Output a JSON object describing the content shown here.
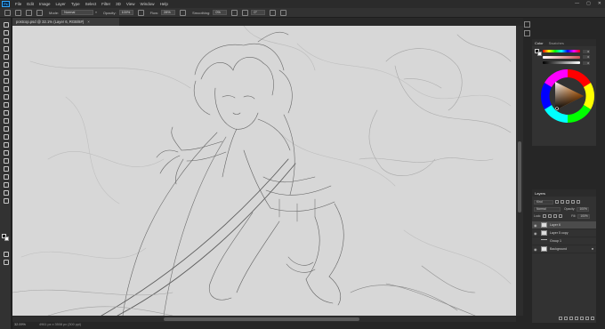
{
  "app": {
    "logo": "Ps",
    "menu": [
      "File",
      "Edit",
      "Image",
      "Layer",
      "Type",
      "Select",
      "Filter",
      "3D",
      "View",
      "Window",
      "Help"
    ],
    "window_controls": [
      "—",
      "▢",
      "✕"
    ]
  },
  "options_bar": {
    "mode_label": "Mode:",
    "mode_value": "Normal",
    "opacity_label": "Opacity:",
    "opacity_value": "100%",
    "flow_label": "Flow:",
    "flow_value": "28%",
    "smoothing_label": "Smoothing:",
    "smoothing_value": "0%",
    "angle_value": "0°"
  },
  "document": {
    "tab_title": "postcop.psd @ 32.1% (Layer 6, RGB/8#)",
    "close_glyph": "×",
    "zoom": "32.09%",
    "size_info": "4961 px x 3508 px (300 ppi)"
  },
  "color_panel": {
    "tabs": [
      "Color",
      "Swatches"
    ],
    "sliders": [
      {
        "value": "0"
      },
      {
        "value": "0"
      },
      {
        "value": "0"
      }
    ]
  },
  "layers_panel": {
    "tabs": [
      "Layers"
    ],
    "kind_label": "Kind",
    "blend_mode": "Normal",
    "opacity_label": "Opacity:",
    "opacity_value": "100%",
    "lock_label": "Lock:",
    "fill_label": "Fill:",
    "fill_value": "100%",
    "layers": [
      {
        "name": "Layer 6",
        "type": "layer",
        "visible": true
      },
      {
        "name": "Layer 5 copy",
        "type": "layer",
        "visible": true
      },
      {
        "name": "Group 1",
        "type": "group",
        "visible": false
      },
      {
        "name": "Background",
        "type": "layer",
        "visible": true,
        "locked": true
      }
    ],
    "selected_layer": 0
  },
  "tools": [
    "move",
    "artboard",
    "marquee",
    "lasso",
    "quick-select",
    "crop",
    "frame",
    "eyedropper",
    "healing",
    "brush",
    "clone-stamp",
    "history-brush",
    "eraser",
    "gradient",
    "blur",
    "dodge",
    "pen",
    "type",
    "path-select",
    "rectangle",
    "hand",
    "zoom",
    "edit-toolbar"
  ],
  "colors": {
    "foreground": "#000000",
    "background": "#ffffff",
    "accent": "#31a8ff"
  }
}
